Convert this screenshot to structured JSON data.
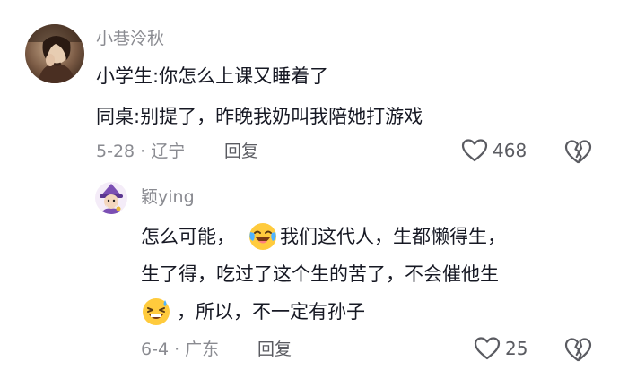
{
  "main_comment": {
    "username": "小巷泠秋",
    "lines": [
      "小学生:你怎么上课又睡着了",
      "同桌:别提了，昨晚我奶叫我陪她打游戏"
    ],
    "date_location": "5-28 · 辽宁",
    "reply_label": "回复",
    "like_count": "468",
    "avatar_icon": "user-avatar-photo"
  },
  "reply": {
    "username": "颖ying",
    "line1_a": "怎么可能，",
    "line1_b": "我们这代人，生都懒得生，",
    "line2": "生了得，吃过了这个生的苦了，不会催他生",
    "line3": "，所以，不一定有孙子",
    "date_location": "6-4 · 广东",
    "reply_label": "回复",
    "like_count": "25",
    "avatar_icon": "cartoon-wizard-avatar",
    "emoji_1": "crying-laughing-emoji",
    "emoji_2": "laughing-sweat-emoji"
  },
  "colors": {
    "text_primary": "#161823",
    "text_secondary": "#8a8b91",
    "action": "#5a5b61",
    "background": "#ffffff"
  }
}
